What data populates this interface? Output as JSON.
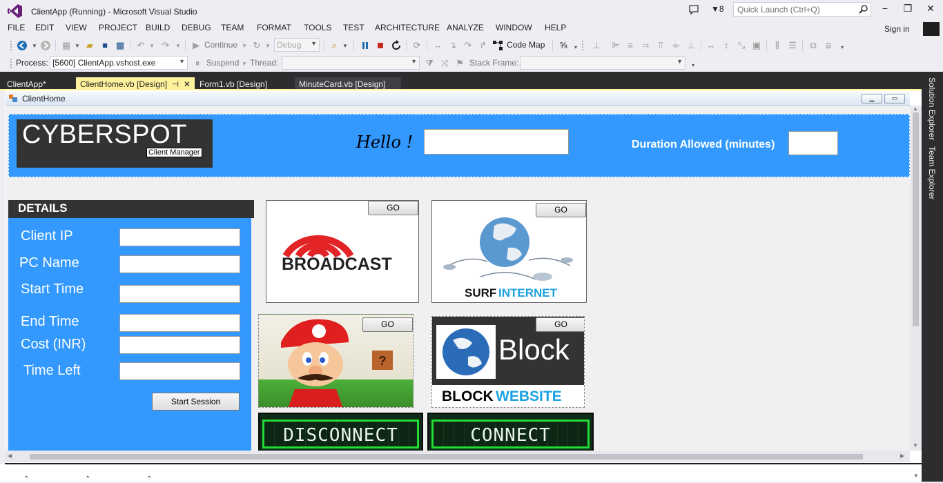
{
  "window": {
    "title": "ClientApp (Running) - Microsoft Visual Studio",
    "notification_count": "8",
    "quick_launch_placeholder": "Quick Launch (Ctrl+Q)",
    "sign_in": "Sign in"
  },
  "menu": [
    "FILE",
    "EDIT",
    "VIEW",
    "PROJECT",
    "BUILD",
    "DEBUG",
    "TEAM",
    "FORMAT",
    "TOOLS",
    "TEST",
    "ARCHITECTURE",
    "ANALYZE",
    "WINDOW",
    "HELP"
  ],
  "toolbar": {
    "continue_label": "Continue",
    "config_value": "Debug",
    "code_map_label": "Code Map",
    "process_label": "Process:",
    "process_value": "[5600] ClientApp.vshost.exe",
    "suspend_label": "Suspend",
    "thread_label": "Thread:",
    "stack_frame_label": "Stack Frame:"
  },
  "tabs": [
    {
      "label": "ClientApp*"
    },
    {
      "label": "ClientHome.vb [Design]",
      "pin": "⊣"
    },
    {
      "label": "Form1.vb [Design]"
    },
    {
      "label": "MinuteCard.vb [Design]"
    }
  ],
  "side_panel": {
    "solution_explorer": "Solution Explorer",
    "team_explorer": "Team Explorer"
  },
  "form": {
    "caption": "ClientHome",
    "logo_title": "CYBERSPOT",
    "logo_subtitle": "Client Manager",
    "hello_label": "Hello !",
    "duration_label": "Duration Allowed (minutes)",
    "details_header": "DETAILS",
    "fields": [
      {
        "label": "Client IP"
      },
      {
        "label": "PC Name"
      },
      {
        "label": "Start Time"
      },
      {
        "label": "End Time"
      },
      {
        "label": "Cost (INR)"
      },
      {
        "label": "Time Left"
      }
    ],
    "start_session": "Start Session",
    "go_label": "GO",
    "broadcast_text": "BROADCAST",
    "surf_text_1": "SURF",
    "surf_text_2": "INTERNET",
    "block_word": "Block",
    "block_text_1": "BLOCK",
    "block_text_2": "WEBSITE",
    "disconnect": "DISCONNECT",
    "connect": "CONNECT"
  },
  "colors": {
    "accent_blue": "#3399FF",
    "dark_panel": "#333333",
    "active_tab": "#FFF29D",
    "connect_green": "#22DD33"
  }
}
